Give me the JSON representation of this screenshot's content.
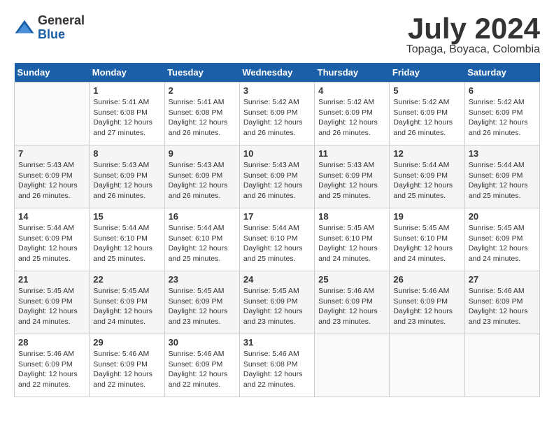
{
  "header": {
    "logo_general": "General",
    "logo_blue": "Blue",
    "month_title": "July 2024",
    "location": "Topaga, Boyaca, Colombia"
  },
  "days_of_week": [
    "Sunday",
    "Monday",
    "Tuesday",
    "Wednesday",
    "Thursday",
    "Friday",
    "Saturday"
  ],
  "weeks": [
    [
      {
        "day": "",
        "info": ""
      },
      {
        "day": "1",
        "info": "Sunrise: 5:41 AM\nSunset: 6:08 PM\nDaylight: 12 hours\nand 27 minutes."
      },
      {
        "day": "2",
        "info": "Sunrise: 5:41 AM\nSunset: 6:08 PM\nDaylight: 12 hours\nand 26 minutes."
      },
      {
        "day": "3",
        "info": "Sunrise: 5:42 AM\nSunset: 6:09 PM\nDaylight: 12 hours\nand 26 minutes."
      },
      {
        "day": "4",
        "info": "Sunrise: 5:42 AM\nSunset: 6:09 PM\nDaylight: 12 hours\nand 26 minutes."
      },
      {
        "day": "5",
        "info": "Sunrise: 5:42 AM\nSunset: 6:09 PM\nDaylight: 12 hours\nand 26 minutes."
      },
      {
        "day": "6",
        "info": "Sunrise: 5:42 AM\nSunset: 6:09 PM\nDaylight: 12 hours\nand 26 minutes."
      }
    ],
    [
      {
        "day": "7",
        "info": "Sunrise: 5:43 AM\nSunset: 6:09 PM\nDaylight: 12 hours\nand 26 minutes."
      },
      {
        "day": "8",
        "info": "Sunrise: 5:43 AM\nSunset: 6:09 PM\nDaylight: 12 hours\nand 26 minutes."
      },
      {
        "day": "9",
        "info": "Sunrise: 5:43 AM\nSunset: 6:09 PM\nDaylight: 12 hours\nand 26 minutes."
      },
      {
        "day": "10",
        "info": "Sunrise: 5:43 AM\nSunset: 6:09 PM\nDaylight: 12 hours\nand 26 minutes."
      },
      {
        "day": "11",
        "info": "Sunrise: 5:43 AM\nSunset: 6:09 PM\nDaylight: 12 hours\nand 25 minutes."
      },
      {
        "day": "12",
        "info": "Sunrise: 5:44 AM\nSunset: 6:09 PM\nDaylight: 12 hours\nand 25 minutes."
      },
      {
        "day": "13",
        "info": "Sunrise: 5:44 AM\nSunset: 6:09 PM\nDaylight: 12 hours\nand 25 minutes."
      }
    ],
    [
      {
        "day": "14",
        "info": "Sunrise: 5:44 AM\nSunset: 6:09 PM\nDaylight: 12 hours\nand 25 minutes."
      },
      {
        "day": "15",
        "info": "Sunrise: 5:44 AM\nSunset: 6:10 PM\nDaylight: 12 hours\nand 25 minutes."
      },
      {
        "day": "16",
        "info": "Sunrise: 5:44 AM\nSunset: 6:10 PM\nDaylight: 12 hours\nand 25 minutes."
      },
      {
        "day": "17",
        "info": "Sunrise: 5:44 AM\nSunset: 6:10 PM\nDaylight: 12 hours\nand 25 minutes."
      },
      {
        "day": "18",
        "info": "Sunrise: 5:45 AM\nSunset: 6:10 PM\nDaylight: 12 hours\nand 24 minutes."
      },
      {
        "day": "19",
        "info": "Sunrise: 5:45 AM\nSunset: 6:10 PM\nDaylight: 12 hours\nand 24 minutes."
      },
      {
        "day": "20",
        "info": "Sunrise: 5:45 AM\nSunset: 6:09 PM\nDaylight: 12 hours\nand 24 minutes."
      }
    ],
    [
      {
        "day": "21",
        "info": "Sunrise: 5:45 AM\nSunset: 6:09 PM\nDaylight: 12 hours\nand 24 minutes."
      },
      {
        "day": "22",
        "info": "Sunrise: 5:45 AM\nSunset: 6:09 PM\nDaylight: 12 hours\nand 24 minutes."
      },
      {
        "day": "23",
        "info": "Sunrise: 5:45 AM\nSunset: 6:09 PM\nDaylight: 12 hours\nand 23 minutes."
      },
      {
        "day": "24",
        "info": "Sunrise: 5:45 AM\nSunset: 6:09 PM\nDaylight: 12 hours\nand 23 minutes."
      },
      {
        "day": "25",
        "info": "Sunrise: 5:46 AM\nSunset: 6:09 PM\nDaylight: 12 hours\nand 23 minutes."
      },
      {
        "day": "26",
        "info": "Sunrise: 5:46 AM\nSunset: 6:09 PM\nDaylight: 12 hours\nand 23 minutes."
      },
      {
        "day": "27",
        "info": "Sunrise: 5:46 AM\nSunset: 6:09 PM\nDaylight: 12 hours\nand 23 minutes."
      }
    ],
    [
      {
        "day": "28",
        "info": "Sunrise: 5:46 AM\nSunset: 6:09 PM\nDaylight: 12 hours\nand 22 minutes."
      },
      {
        "day": "29",
        "info": "Sunrise: 5:46 AM\nSunset: 6:09 PM\nDaylight: 12 hours\nand 22 minutes."
      },
      {
        "day": "30",
        "info": "Sunrise: 5:46 AM\nSunset: 6:09 PM\nDaylight: 12 hours\nand 22 minutes."
      },
      {
        "day": "31",
        "info": "Sunrise: 5:46 AM\nSunset: 6:08 PM\nDaylight: 12 hours\nand 22 minutes."
      },
      {
        "day": "",
        "info": ""
      },
      {
        "day": "",
        "info": ""
      },
      {
        "day": "",
        "info": ""
      }
    ]
  ]
}
